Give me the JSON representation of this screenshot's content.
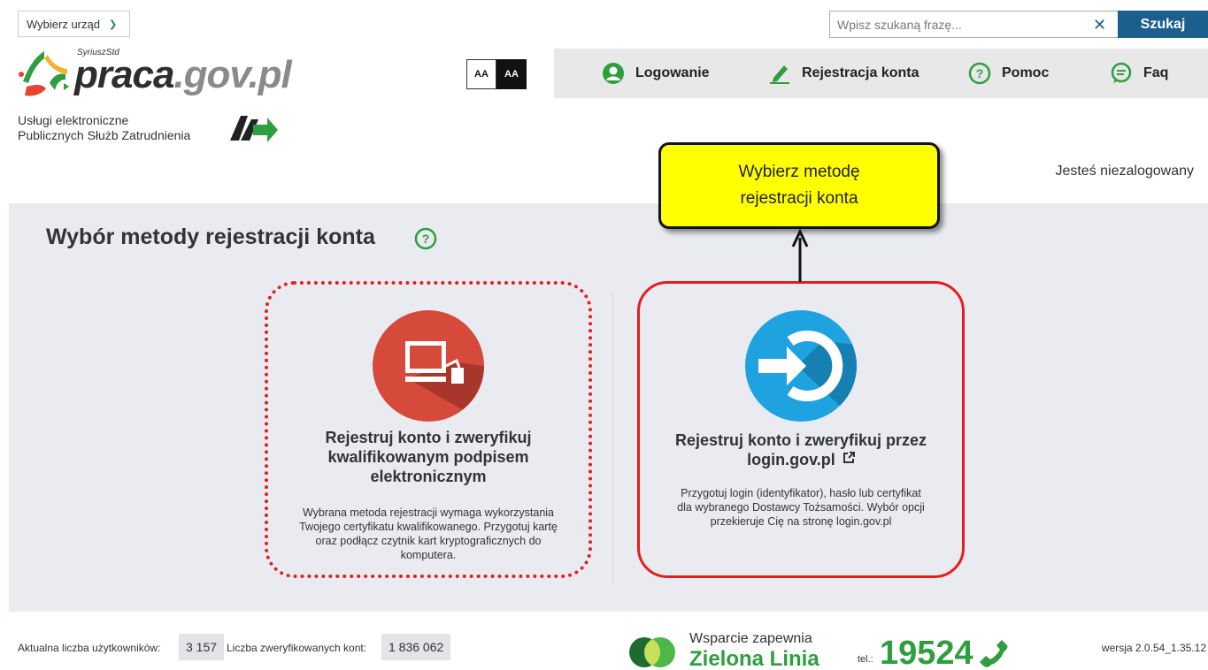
{
  "top": {
    "office_button_label": "Wybierz urząd",
    "search": {
      "placeholder": "Wpisz szukaną frazę...",
      "value": "",
      "clear_symbol": "✕",
      "button_label": "Szukaj"
    }
  },
  "logo": {
    "super": "SyriuszStd",
    "main": "praca",
    "domain": ".gov.pl"
  },
  "services": {
    "line1": "Usługi elektroniczne",
    "line2": "Publicznych Służb Zatrudnienia"
  },
  "contrast": {
    "normal_label": "AA",
    "high_label": "AA"
  },
  "nav": [
    {
      "label": "Logowanie",
      "icon": "user-icon"
    },
    {
      "label": "Rejestracja konta",
      "icon": "pencil-icon"
    },
    {
      "label": "Pomoc",
      "icon": "help-icon"
    },
    {
      "label": "Faq",
      "icon": "chat-icon"
    }
  ],
  "user_status": "Jesteś niezalogowany",
  "callout": {
    "line1": "Wybierz metodę",
    "line2": "rejestracji konta"
  },
  "main": {
    "title": "Wybór metody rejestracji konta",
    "cards": [
      {
        "title_lines": [
          "Rejestruj konto i zweryfikuj",
          "kwalifikowanym podpisem",
          "elektronicznym"
        ],
        "desc_lines": [
          "Wybrana metoda rejestracji wymaga wykorzystania",
          "Twojego certyfikatu kwalifikowanego. Przygotuj kartę",
          "oraz podłącz czytnik kart kryptograficznych do",
          "komputera."
        ],
        "icon": "computer-card-reader-icon",
        "color": "#d64a3b"
      },
      {
        "title_lines": [
          "Rejestruj konto i zweryfikuj przez",
          "login.gov.pl"
        ],
        "desc_lines": [
          "Przygotuj login (identyfikator), hasło lub certyfikat",
          "dla wybranego Dostawcy Tożsamości. Wybór opcji",
          "przekieruje Cię na stronę login.gov.pl"
        ],
        "icon": "login-arrow-icon",
        "color": "#1fa3e0"
      }
    ]
  },
  "footer": {
    "users_label": "Aktualna liczba użytkowników:",
    "users_value": "3 157",
    "verified_label": "Liczba zweryfikowanych kont:",
    "verified_value": "1 836 062",
    "support_label": "Wsparcie zapewnia",
    "support_name": "Zielona Linia",
    "tel_label": "tel.:",
    "tel_number": "19524",
    "version": "wersja 2.0.54_1.35.12"
  },
  "colors": {
    "accent_blue": "#1b5f8e",
    "highlight_red": "#e41e1e",
    "callout_yellow": "#ffff00",
    "green": "#2e9e3e"
  }
}
